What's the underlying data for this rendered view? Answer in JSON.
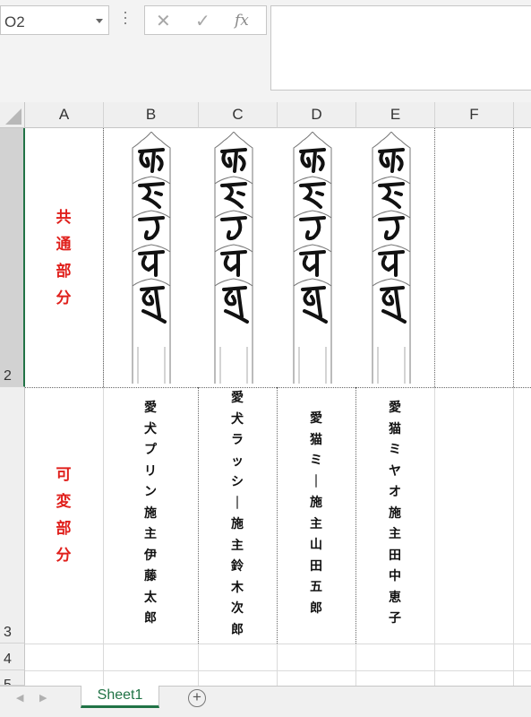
{
  "name_box": {
    "value": "O2"
  },
  "formula_bar": {
    "cancel_icon": "✕",
    "enter_icon": "✓",
    "fx_label": "fx",
    "content": ""
  },
  "columns": [
    "A",
    "B",
    "C",
    "D",
    "E",
    "F"
  ],
  "rows": [
    "2",
    "3",
    "4",
    "5"
  ],
  "row2_label": [
    "共",
    "通",
    "部",
    "分"
  ],
  "row3_label": [
    "可",
    "変",
    "部",
    "分"
  ],
  "vertical_texts": {
    "B": "愛犬プリン施主伊藤太郎",
    "C": "愛犬ラッシー施主鈴木次郎",
    "D": "愛猫ミー施主山田五郎",
    "E": "愛猫ミヤオ施主田中恵子"
  },
  "sheet_tabs": [
    "Sheet1"
  ],
  "colors": {
    "accent_green": "#217346",
    "label_red": "#e0201c"
  }
}
